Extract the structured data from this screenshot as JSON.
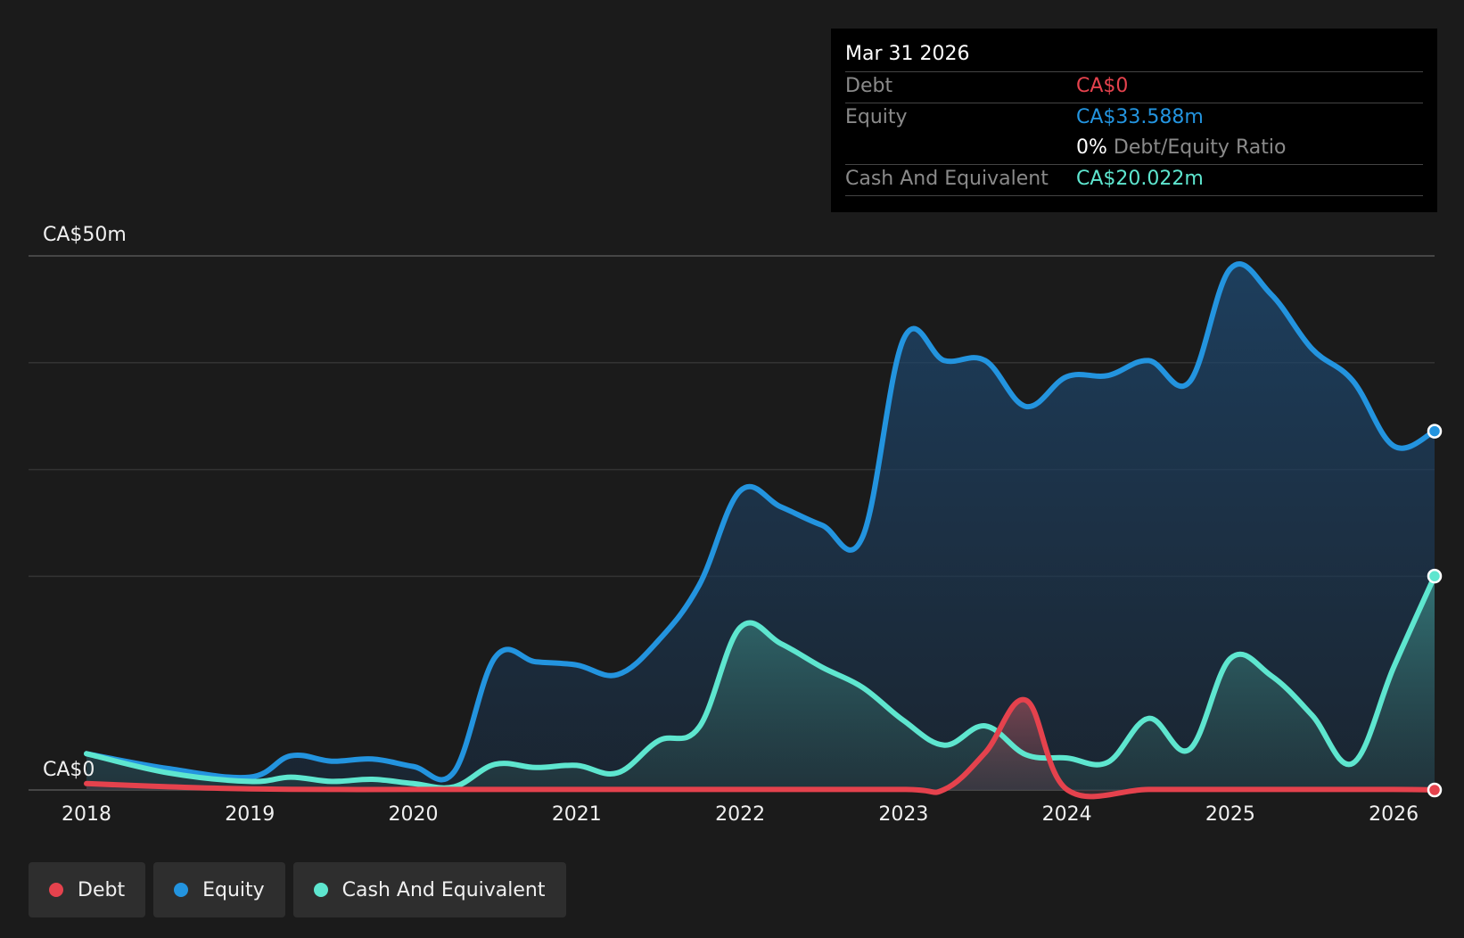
{
  "tooltip": {
    "date": "Mar 31 2026",
    "debt_label": "Debt",
    "debt_value": "CA$0",
    "equity_label": "Equity",
    "equity_value": "CA$33.588m",
    "ratio_value": "0%",
    "ratio_label": "Debt/Equity Ratio",
    "cash_label": "Cash And Equivalent",
    "cash_value": "CA$20.022m"
  },
  "legend": [
    {
      "label": "Debt",
      "color": "#e5424d"
    },
    {
      "label": "Equity",
      "color": "#2394df"
    },
    {
      "label": "Cash And Equivalent",
      "color": "#5ee6cf"
    }
  ],
  "colors": {
    "debt": "#e5424d",
    "equity": "#2394df",
    "cash": "#5ee6cf"
  },
  "chart_data": {
    "type": "area",
    "y_tick_labels": {
      "top": "CA$50m",
      "bottom": "CA$0"
    },
    "ylim": [
      0,
      50
    ],
    "xlim": [
      2018,
      2026.25
    ],
    "x_ticks": [
      "2018",
      "2019",
      "2020",
      "2021",
      "2022",
      "2023",
      "2024",
      "2025",
      "2026"
    ],
    "grid": true,
    "legend_position": "bottom-left",
    "series": [
      {
        "name": "Equity",
        "points": [
          [
            2018,
            3.4
          ],
          [
            2018.5,
            2.0
          ],
          [
            2019,
            1.2
          ],
          [
            2019.25,
            3.2
          ],
          [
            2019.5,
            2.7
          ],
          [
            2019.75,
            2.9
          ],
          [
            2020,
            2.2
          ],
          [
            2020.25,
            1.7
          ],
          [
            2020.5,
            12.4
          ],
          [
            2020.75,
            12.0
          ],
          [
            2021,
            11.7
          ],
          [
            2021.25,
            10.8
          ],
          [
            2021.5,
            14.0
          ],
          [
            2021.75,
            19.2
          ],
          [
            2022,
            28.0
          ],
          [
            2022.25,
            26.5
          ],
          [
            2022.5,
            24.8
          ],
          [
            2022.75,
            23.7
          ],
          [
            2023,
            42.2
          ],
          [
            2023.25,
            40.2
          ],
          [
            2023.5,
            40.2
          ],
          [
            2023.75,
            35.9
          ],
          [
            2024,
            38.7
          ],
          [
            2024.25,
            38.8
          ],
          [
            2024.5,
            40.2
          ],
          [
            2024.75,
            38.2
          ],
          [
            2025,
            48.8
          ],
          [
            2025.25,
            46.4
          ],
          [
            2025.5,
            41.3
          ],
          [
            2025.75,
            38.3
          ],
          [
            2026,
            32.2
          ],
          [
            2026.25,
            33.588
          ]
        ]
      },
      {
        "name": "Cash And Equivalent",
        "points": [
          [
            2018,
            3.4
          ],
          [
            2018.5,
            1.6
          ],
          [
            2019,
            0.8
          ],
          [
            2019.25,
            1.2
          ],
          [
            2019.5,
            0.8
          ],
          [
            2019.75,
            1.0
          ],
          [
            2020,
            0.6
          ],
          [
            2020.25,
            0.3
          ],
          [
            2020.5,
            2.4
          ],
          [
            2020.75,
            2.1
          ],
          [
            2021,
            2.3
          ],
          [
            2021.25,
            1.6
          ],
          [
            2021.5,
            4.6
          ],
          [
            2021.75,
            5.9
          ],
          [
            2022,
            15.2
          ],
          [
            2022.25,
            13.7
          ],
          [
            2022.5,
            11.5
          ],
          [
            2022.75,
            9.6
          ],
          [
            2023,
            6.5
          ],
          [
            2023.25,
            4.2
          ],
          [
            2023.5,
            6.0
          ],
          [
            2023.75,
            3.3
          ],
          [
            2024,
            3.0
          ],
          [
            2024.25,
            2.6
          ],
          [
            2024.5,
            6.7
          ],
          [
            2024.75,
            3.8
          ],
          [
            2025,
            12.3
          ],
          [
            2025.25,
            10.7
          ],
          [
            2025.5,
            7.0
          ],
          [
            2025.75,
            2.5
          ],
          [
            2026,
            11.5
          ],
          [
            2026.25,
            20.022
          ]
        ]
      },
      {
        "name": "Debt",
        "points": [
          [
            2018,
            0.6
          ],
          [
            2018.5,
            0.3
          ],
          [
            2019,
            0.1
          ],
          [
            2019.5,
            0.05
          ],
          [
            2020,
            0.05
          ],
          [
            2021,
            0.05
          ],
          [
            2022,
            0.05
          ],
          [
            2023,
            0.05
          ],
          [
            2023.25,
            0.05
          ],
          [
            2023.5,
            3.5
          ],
          [
            2023.75,
            8.4
          ],
          [
            2024,
            0.05
          ],
          [
            2024.5,
            0.05
          ],
          [
            2025,
            0.05
          ],
          [
            2026,
            0.05
          ],
          [
            2026.25,
            0
          ]
        ]
      }
    ]
  }
}
